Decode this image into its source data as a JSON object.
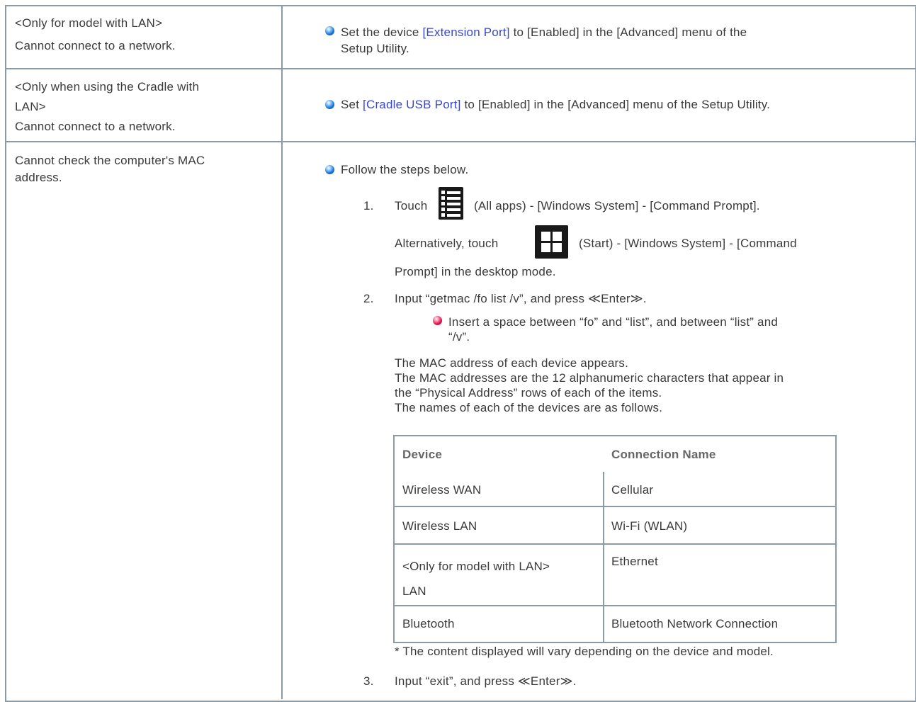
{
  "rows": [
    {
      "problem": [
        "<Only for model with LAN>",
        "Cannot connect to a network."
      ],
      "solution": {
        "pre": "Set the device ",
        "link": "[Extension Port]",
        "post": " to [Enabled] in the [Advanced] menu of the",
        "line2": "Setup Utility."
      }
    },
    {
      "problem": [
        "<Only when using the Cradle with",
        "LAN>",
        "Cannot connect to a network."
      ],
      "solution": {
        "pre": "Set ",
        "link": "[Cradle USB Port]",
        "post": " to [Enabled] in the [Advanced] menu of the Setup Utility."
      }
    },
    {
      "problem": [
        "Cannot check the computer's MAC",
        "address."
      ],
      "intro": "Follow the steps below.",
      "steps": [
        {
          "num": "1.",
          "pre": "Touch",
          "icon": "all-apps-icon",
          "post": "(All apps) - [Windows System] - [Command Prompt].",
          "alt_pre": "Alternatively, touch",
          "alt_icon": "windows-start-icon",
          "alt_post": "(Start) - [Windows System] - [Command",
          "alt_line2": "Prompt] in the desktop mode."
        },
        {
          "num": "2.",
          "text": "Input “getmac /fo list /v”, and press ≪Enter≫.",
          "note": [
            "Insert a space between “fo” and “list”, and between “list” and",
            "“/v”."
          ],
          "para": [
            "The MAC address of each device appears.",
            "The MAC addresses are the 12 alphanumeric characters that appear in",
            "the “Physical Address” rows of each of the items.",
            "The names of each of the devices are as follows."
          ]
        },
        {
          "num": "3.",
          "text": "Input “exit”, and press ≪Enter≫."
        }
      ],
      "table": {
        "headers": [
          "Device",
          "Connection Name"
        ],
        "rows": [
          [
            "Wireless WAN",
            "Cellular"
          ],
          [
            "Wireless LAN",
            "Wi-Fi (WLAN)"
          ],
          [
            "<Only for model with LAN>",
            "LAN",
            "Ethernet"
          ],
          [
            "Bluetooth",
            "Bluetooth Network Connection"
          ]
        ]
      },
      "footnote": "* The content displayed will vary depending on the device and model."
    }
  ],
  "colors": {
    "border": "#8c9aa6",
    "link": "#3a48c8",
    "bullet_blue": "#1a73d9",
    "bullet_red": "#e0144e"
  }
}
